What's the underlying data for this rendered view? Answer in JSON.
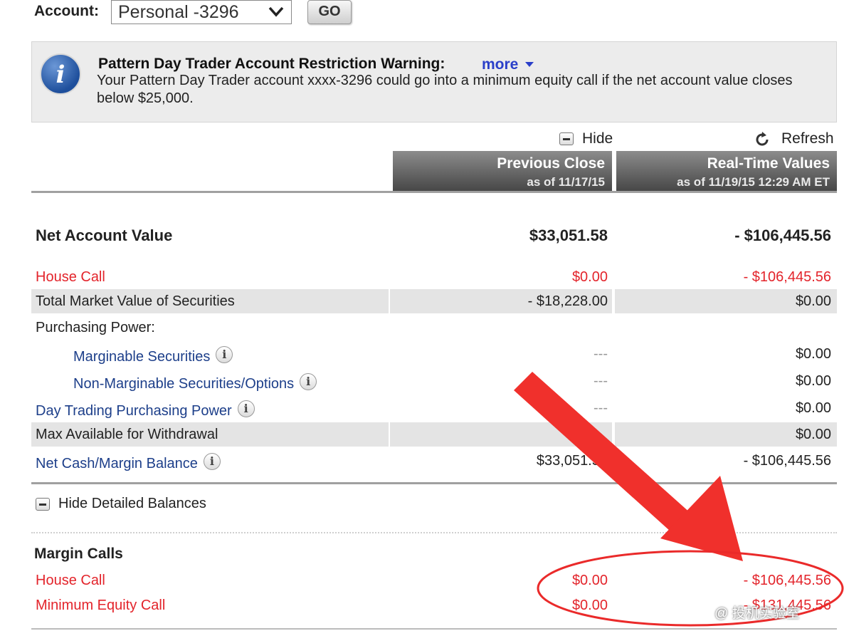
{
  "account": {
    "label": "Account:",
    "selected": "Personal -3296",
    "go_label": "GO"
  },
  "warning": {
    "title": "Pattern Day Trader Account Restriction Warning:",
    "more_label": "more",
    "text": "Your Pattern Day Trader account xxxx-3296 could go into a minimum equity call if the net account value closes below $25,000."
  },
  "controls": {
    "hide_label": "Hide",
    "refresh_label": "Refresh"
  },
  "columns": {
    "previous": {
      "title": "Previous Close",
      "subtitle": "as of 11/17/15"
    },
    "realtime": {
      "title": "Real-Time Values",
      "subtitle": "as of 11/19/15 12:29 AM ET"
    }
  },
  "balances": {
    "net_account_value": {
      "label": "Net Account Value",
      "previous": "$33,051.58",
      "realtime": "- $106,445.56"
    },
    "house_call": {
      "label": "House Call",
      "previous": "$0.00",
      "realtime": "- $106,445.56"
    },
    "total_market_value": {
      "label": "Total Market Value of Securities",
      "previous": "- $18,228.00",
      "realtime": "$0.00"
    },
    "purchasing_power": {
      "label": "Purchasing Power:"
    },
    "marginable": {
      "label": "Marginable Securities",
      "previous": "---",
      "realtime": "$0.00"
    },
    "non_marginable": {
      "label": "Non-Marginable Securities/Options",
      "previous": "---",
      "realtime": "$0.00"
    },
    "day_trading": {
      "label": "Day Trading Purchasing Power",
      "previous": "---",
      "realtime": "$0.00"
    },
    "max_withdrawal": {
      "label": "Max Available for Withdrawal",
      "previous": "",
      "realtime": "$0.00"
    },
    "net_cash": {
      "label": "Net Cash/Margin Balance",
      "previous": "$33,051.58",
      "realtime": "- $106,445.56"
    }
  },
  "detailed_toggle": "Hide Detailed Balances",
  "margin_calls": {
    "heading": "Margin Calls",
    "house_call": {
      "label": "House Call",
      "previous": "$0.00",
      "realtime": "- $106,445.56"
    },
    "min_equity_call": {
      "label": "Minimum Equity Call",
      "previous": "$0.00",
      "realtime": "- $131,445.56"
    }
  },
  "watermark": "@ 投机实验室",
  "colors": {
    "alert_red": "#e3242b",
    "link_blue": "#1d3f8a",
    "header_gray": "#5a5a5a"
  }
}
